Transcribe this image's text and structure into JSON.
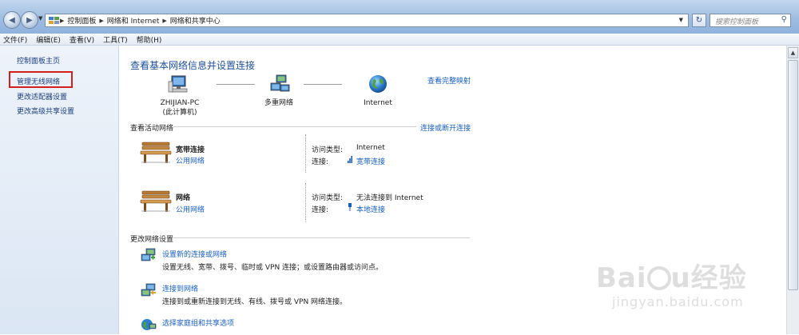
{
  "address_bar": {
    "crumbs": [
      "控制面板",
      "网络和 Internet",
      "网络和共享中心"
    ],
    "search_placeholder": "搜索控制面板"
  },
  "menu": [
    "文件(F)",
    "编辑(E)",
    "查看(V)",
    "工具(T)",
    "帮助(H)"
  ],
  "left_pane": {
    "items": [
      "控制面板主页",
      "管理无线网络",
      "更改适配器设置",
      "更改高级共享设置"
    ],
    "highlighted_item": "管理无线网络",
    "highlight_color": "#d21f1f"
  },
  "main": {
    "title": "查看基本网络信息并设置连接",
    "full_map_link": "查看完整映射",
    "network_map": {
      "computer_name": "ZHIJIAN-PC",
      "computer_sub": "(此计算机)",
      "middle_label": "多重网络",
      "internet_label": "Internet"
    },
    "active_networks": {
      "title": "查看活动网络",
      "link": "连接或断开连接",
      "items": [
        {
          "name": "宽带连接",
          "type": "公用网络",
          "access_label": "访问类型:",
          "access_value": "Internet",
          "connection_label": "连接:",
          "connection_value": "宽带连接"
        },
        {
          "name": "网络",
          "type": "公用网络",
          "access_label": "访问类型:",
          "access_value": "无法连接到 Internet",
          "connection_label": "连接:",
          "connection_value": "本地连接"
        }
      ]
    },
    "change_settings": {
      "title": "更改网络设置",
      "tasks": [
        {
          "link": "设置新的连接或网络",
          "desc": "设置无线、宽带、拨号、临时或 VPN 连接；或设置路由器或访问点。"
        },
        {
          "link": "连接到网络",
          "desc": "连接到或重新连接到无线、有线、拨号或 VPN 网络连接。"
        },
        {
          "link": "选择家庭组和共享选项",
          "desc": ""
        }
      ]
    }
  },
  "colors": {
    "link": "#1a5fbf",
    "title": "#1e4f9a",
    "left_link": "#1a3d7c"
  }
}
